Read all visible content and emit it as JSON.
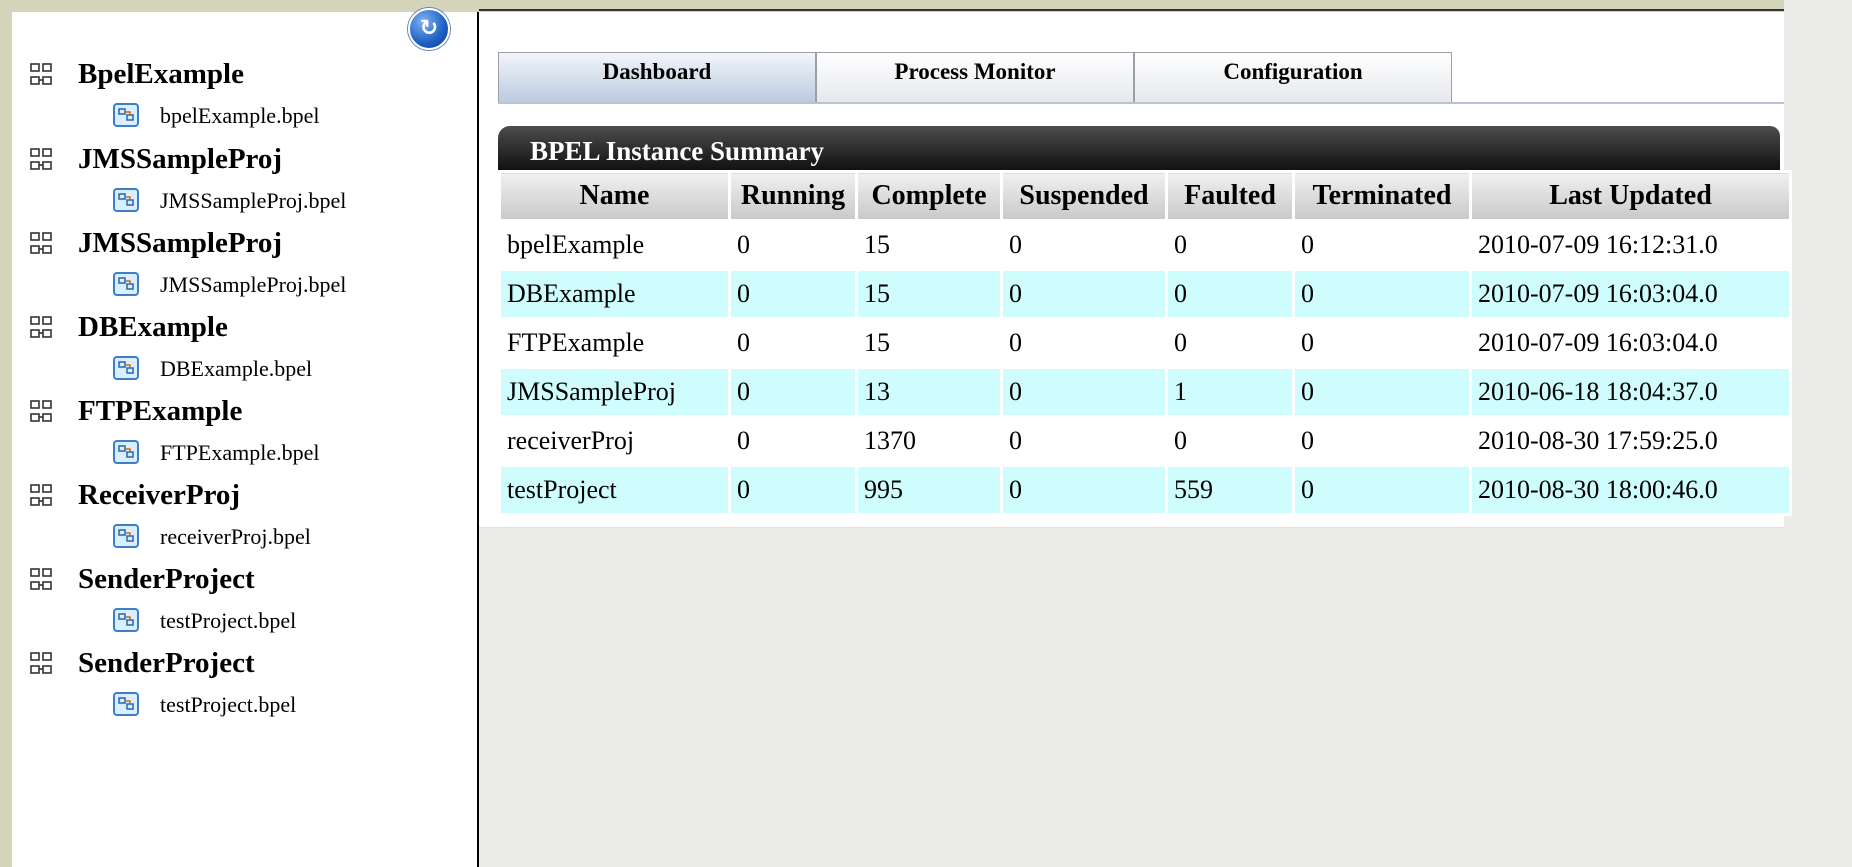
{
  "sidebar": {
    "projects": [
      {
        "name": "BpelExample",
        "file": "bpelExample.bpel"
      },
      {
        "name": "JMSSampleProj",
        "file": "JMSSampleProj.bpel"
      },
      {
        "name": "JMSSampleProj",
        "file": "JMSSampleProj.bpel"
      },
      {
        "name": "DBExample",
        "file": "DBExample.bpel"
      },
      {
        "name": "FTPExample",
        "file": "FTPExample.bpel"
      },
      {
        "name": "ReceiverProj",
        "file": "receiverProj.bpel"
      },
      {
        "name": "SenderProject",
        "file": "testProject.bpel"
      },
      {
        "name": "SenderProject",
        "file": "testProject.bpel"
      }
    ],
    "project_icon": "project-tree-icon",
    "file_icon": "bpel-file-icon",
    "brand_icon": "app-logo-icon"
  },
  "tabs": [
    {
      "label": "Dashboard",
      "active": true
    },
    {
      "label": "Process Monitor",
      "active": false
    },
    {
      "label": "Configuration",
      "active": false
    }
  ],
  "summary": {
    "title": "BPEL Instance Summary",
    "columns": [
      "Name",
      "Running",
      "Complete",
      "Suspended",
      "Faulted",
      "Terminated",
      "Last Updated"
    ],
    "rows": [
      [
        "bpelExample",
        "0",
        "15",
        "0",
        "0",
        "0",
        "2010-07-09 16:12:31.0"
      ],
      [
        "DBExample",
        "0",
        "15",
        "0",
        "0",
        "0",
        "2010-07-09 16:03:04.0"
      ],
      [
        "FTPExample",
        "0",
        "15",
        "0",
        "0",
        "0",
        "2010-07-09 16:03:04.0"
      ],
      [
        "JMSSampleProj",
        "0",
        "13",
        "0",
        "1",
        "0",
        "2010-06-18 18:04:37.0"
      ],
      [
        "receiverProj",
        "0",
        "1370",
        "0",
        "0",
        "0",
        "2010-08-30 17:59:25.0"
      ],
      [
        "testProject",
        "0",
        "995",
        "0",
        "559",
        "0",
        "2010-08-30 18:00:46.0"
      ]
    ]
  },
  "colors": {
    "row_alt": "#cffdfd",
    "header_bar": "#1a1a1a",
    "active_tab": "#bccbe0",
    "frame": "#d4d5bb"
  }
}
